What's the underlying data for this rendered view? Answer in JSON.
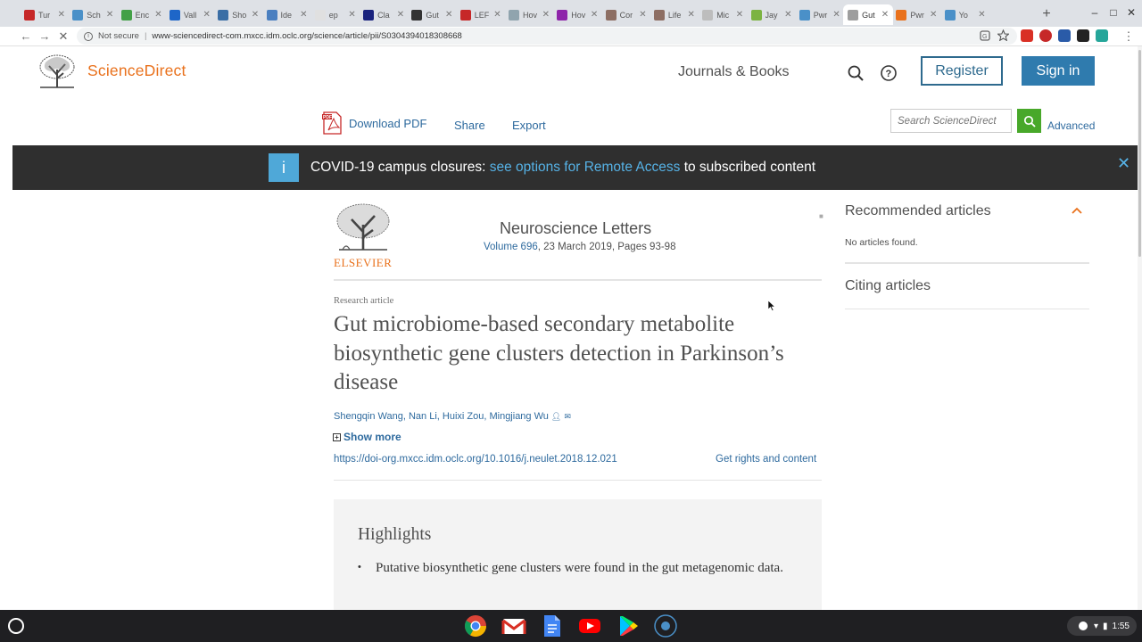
{
  "browser": {
    "tabs": [
      {
        "label": "Tur",
        "color": "#c62828"
      },
      {
        "label": "Sch",
        "color": "#4a90c8"
      },
      {
        "label": "Enc",
        "color": "#43a047"
      },
      {
        "label": "Vall",
        "color": "#1e66c8"
      },
      {
        "label": "Sho",
        "color": "#3a6ea5"
      },
      {
        "label": "Ide",
        "color": "#4a7fc0"
      },
      {
        "label": "ep",
        "color": "#e0e0e0"
      },
      {
        "label": "Cla",
        "color": "#1a237e"
      },
      {
        "label": "Gut",
        "color": "#333333"
      },
      {
        "label": "LEF",
        "color": "#c62828"
      },
      {
        "label": "Hov",
        "color": "#90a4ae"
      },
      {
        "label": "Hov",
        "color": "#8e24aa"
      },
      {
        "label": "Cor",
        "color": "#8d6e63"
      },
      {
        "label": "Life",
        "color": "#8d6e63"
      },
      {
        "label": "Mic",
        "color": "#bdbdbd"
      },
      {
        "label": "Jay",
        "color": "#7cb342"
      },
      {
        "label": "Pwr",
        "color": "#4a90c8"
      },
      {
        "label": "Gut",
        "color": "#9e9e9e"
      },
      {
        "label": "Pwr",
        "color": "#e9711c"
      },
      {
        "label": "Yo",
        "color": "#4a90c8"
      }
    ],
    "active_tab": 17,
    "url_prefix": "Not secure",
    "url": "www-sciencedirect-com.mxcc.idm.oclc.org/science/article/pii/S0304394018308668"
  },
  "header": {
    "brand": "ScienceDirect",
    "journals_books": "Journals & Books",
    "register": "Register",
    "sign_in": "Sign in"
  },
  "toolbar": {
    "download_pdf": "Download PDF",
    "share": "Share",
    "export": "Export",
    "search_placeholder": "Search ScienceDirect",
    "advanced": "Advanced"
  },
  "banner": {
    "info": "i",
    "text_before": "COVID-19 campus closures: ",
    "link": "see options for Remote Access",
    "text_after": " to subscribed content",
    "close": "✕"
  },
  "article": {
    "publisher": "ELSEVIER",
    "journal": "Neuroscience Letters",
    "volume_link": "Volume 696",
    "volume_rest": ", 23 March 2019, Pages 93-98",
    "type": "Research article",
    "title": "Gut microbiome-based secondary metabolite biosynthetic gene clusters detection in Parkinson’s disease",
    "authors": "Shengqin Wang, Nan Li, Huixi Zou, Mingjiang Wu",
    "show_more": "Show more",
    "doi": "https://doi-org.mxcc.idm.oclc.org/10.1016/j.neulet.2018.12.021",
    "rights": "Get rights and content",
    "highlights_title": "Highlights",
    "highlights": [
      "Putative biosynthetic gene clusters were found in the gut metagenomic data."
    ]
  },
  "sidebar": {
    "recommended": "Recommended articles",
    "no_articles": "No articles found.",
    "citing": "Citing articles"
  },
  "system": {
    "time": "1:55"
  }
}
